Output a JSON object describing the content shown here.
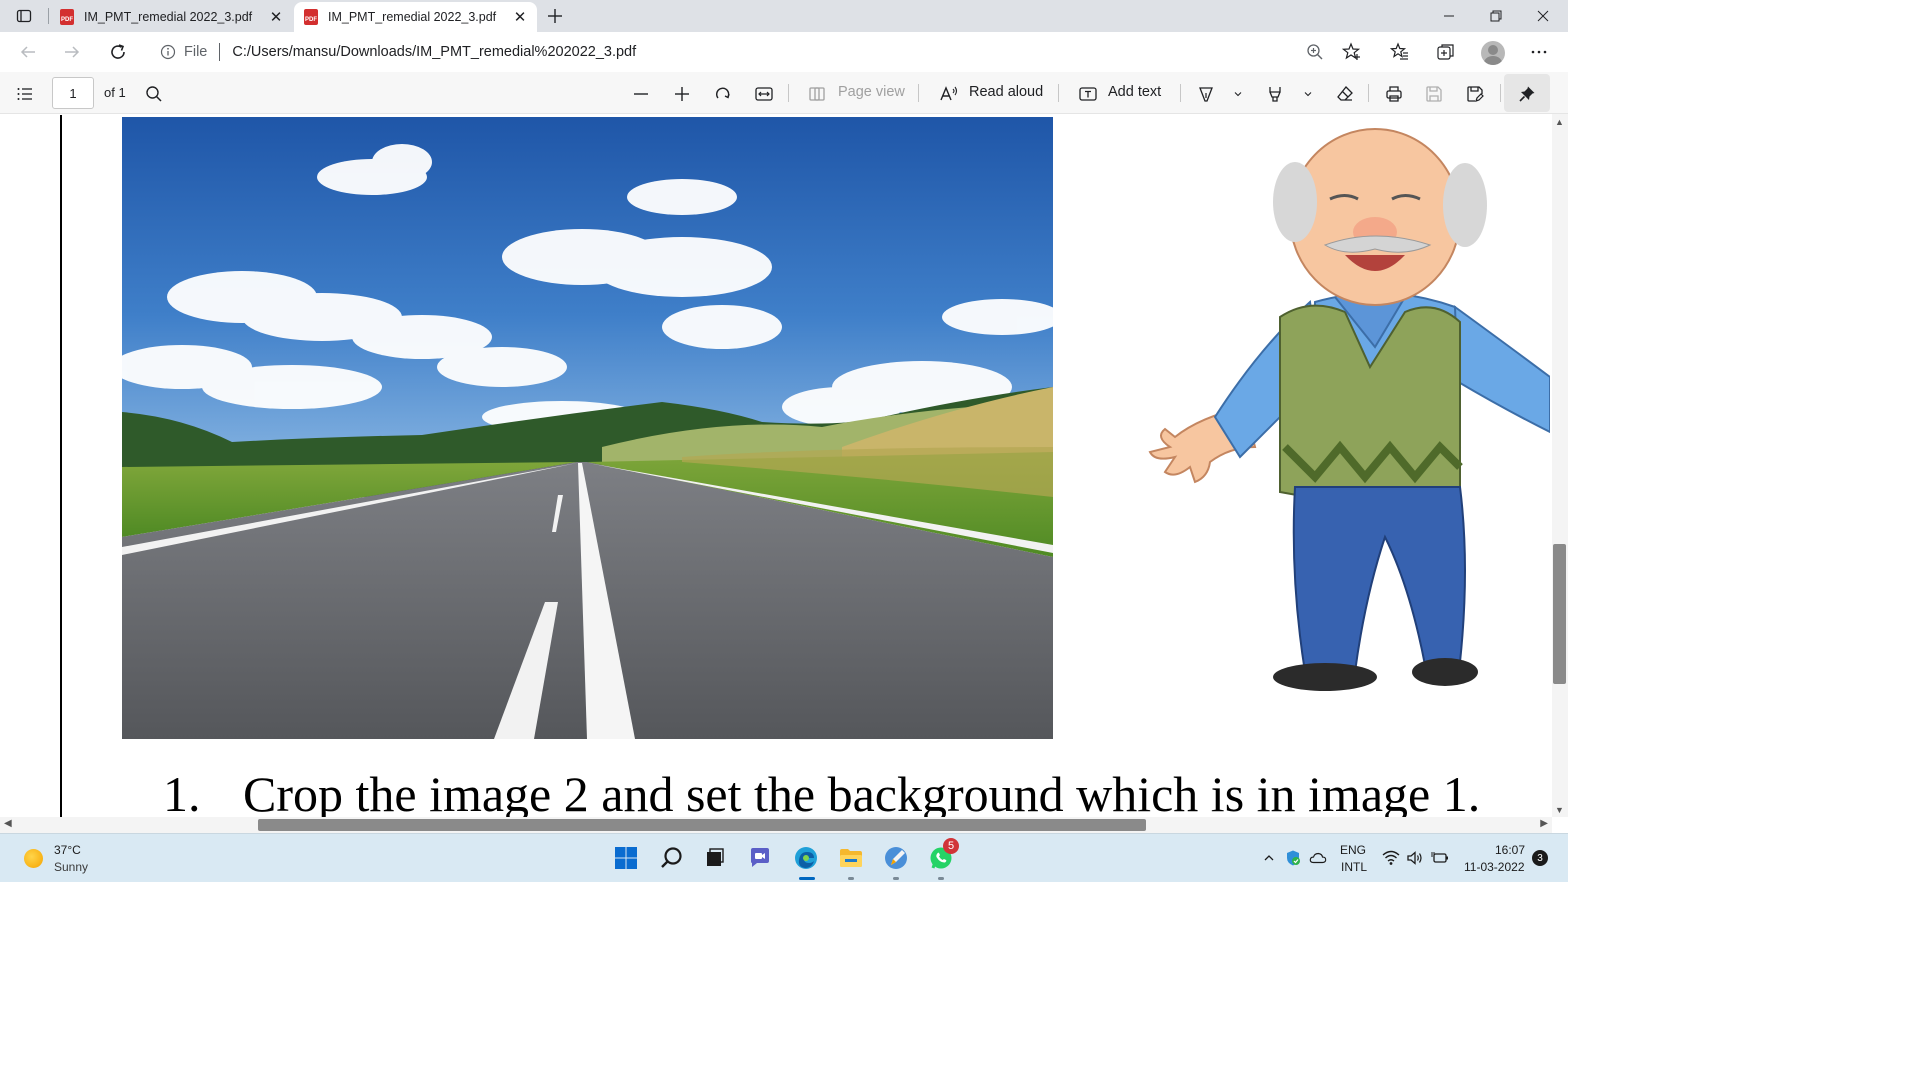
{
  "tabs": [
    {
      "title": "IM_PMT_remedial 2022_3.pdf",
      "active": false
    },
    {
      "title": "IM_PMT_remedial 2022_3.pdf",
      "active": true
    }
  ],
  "address": {
    "scheme": "File",
    "url": "C:/Users/mansu/Downloads/IM_PMT_remedial%202022_3.pdf"
  },
  "pdf_toolbar": {
    "page_number": "1",
    "page_count": "of 1",
    "page_view_label": "Page view",
    "read_aloud_label": "Read aloud",
    "add_text_label": "Add text"
  },
  "document": {
    "list_number": "1.",
    "instruction": "Crop the image 2 and set the background which is in image 1."
  },
  "taskbar": {
    "weather_temp": "37°C",
    "weather_condition": "Sunny",
    "whatsapp_badge": "5",
    "lang_top": "ENG",
    "lang_bottom": "INTL",
    "time": "16:07",
    "date": "11-03-2022",
    "notifications": "3"
  }
}
